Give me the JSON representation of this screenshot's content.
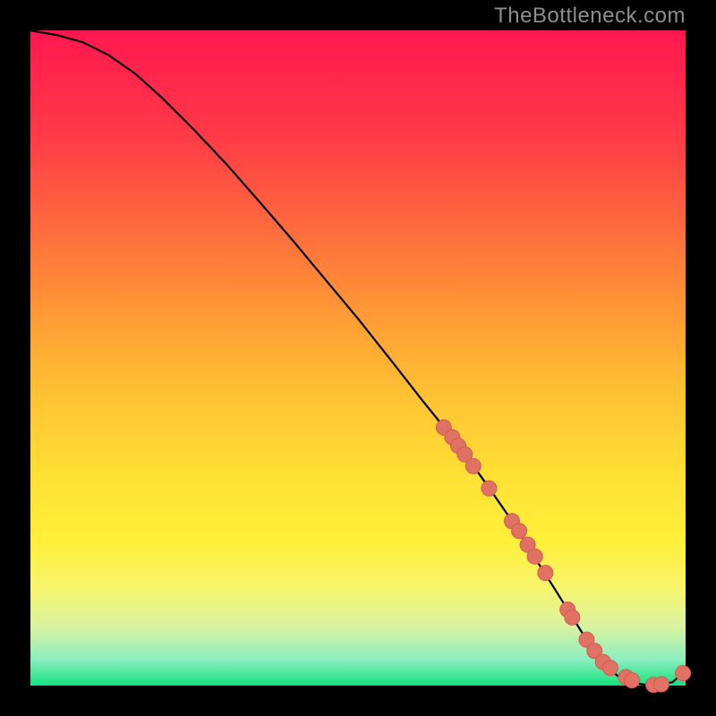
{
  "watermark": "TheBottleneck.com",
  "colors": {
    "curve": "#000000",
    "marker_fill": "#e07264",
    "marker_stroke": "#d55a4f"
  },
  "chart_data": {
    "type": "line",
    "title": "",
    "xlabel": "",
    "ylabel": "",
    "xlim": [
      0,
      100
    ],
    "ylim": [
      0,
      100
    ],
    "grid": false,
    "series": [
      {
        "name": "curve",
        "x": [
          0,
          4,
          8,
          12,
          16,
          20,
          25,
          30,
          35,
          40,
          45,
          50,
          55,
          60,
          63,
          66,
          69,
          72,
          74,
          77,
          80,
          82,
          84,
          86,
          88,
          90,
          92,
          94,
          96,
          98,
          100
        ],
        "y": [
          100,
          99.3,
          98.2,
          96.2,
          93.4,
          89.8,
          84.8,
          79.5,
          73.8,
          68.0,
          62.0,
          56.0,
          49.7,
          43.3,
          39.6,
          35.7,
          31.6,
          27.3,
          24.4,
          19.5,
          14.8,
          11.6,
          8.4,
          5.3,
          2.8,
          1.2,
          0.4,
          0.1,
          0.2,
          0.5,
          2.3
        ],
        "markers": false
      },
      {
        "name": "markers",
        "x": [
          63.1,
          64.4,
          65.3,
          66.3,
          67.6,
          70.0,
          73.5,
          74.6,
          75.9,
          77.0,
          78.6,
          82.0,
          82.7,
          84.9,
          86.1,
          87.4,
          88.5,
          90.9,
          91.8,
          95.1,
          96.3,
          99.6
        ],
        "y": [
          39.4,
          37.9,
          36.6,
          35.3,
          33.5,
          30.1,
          25.1,
          23.6,
          21.5,
          19.7,
          17.2,
          11.6,
          10.4,
          7.0,
          5.3,
          3.6,
          2.7,
          1.3,
          0.8,
          0.1,
          0.2,
          1.9
        ],
        "markers": true
      }
    ]
  }
}
